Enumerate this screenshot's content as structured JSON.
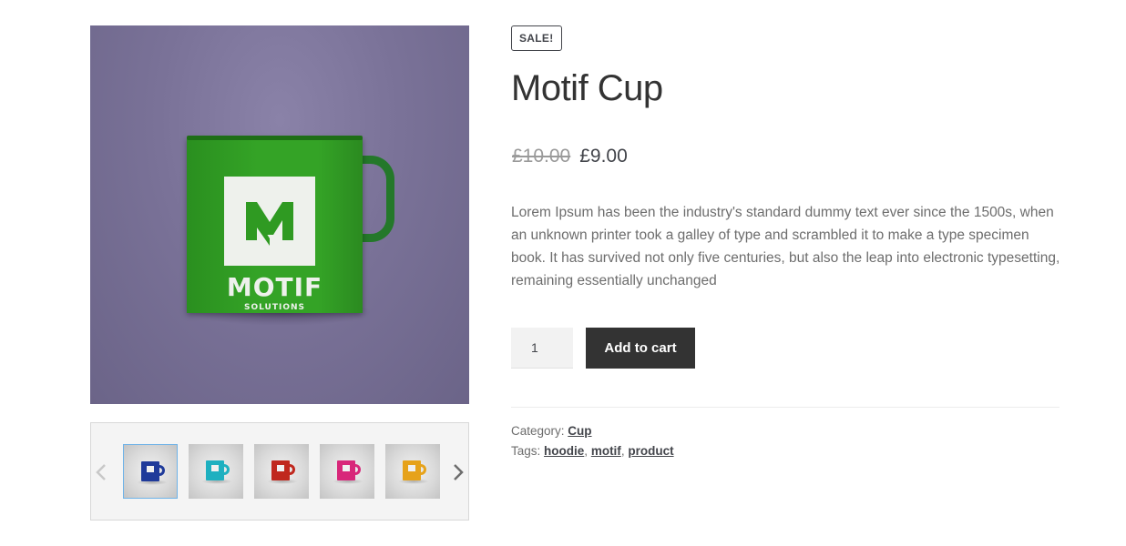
{
  "product": {
    "sale_badge": "SALE!",
    "title": "Motif Cup",
    "price_old": "£10.00",
    "price_new": "£9.00",
    "description": "Lorem Ipsum has been the industry's standard dummy text ever since the 1500s, when an unknown printer took a galley of type and scrambled it to make a type specimen book. It has survived not only five centuries, but also the leap into electronic typesetting, remaining essentially unchanged",
    "quantity": "1",
    "add_to_cart_label": "Add to cart"
  },
  "main_image": {
    "logo_text": "MOTIF",
    "logo_subtext": "SOLUTIONS",
    "mug_color": "#34a326",
    "background_color": "#7a7298"
  },
  "thumbnails": [
    {
      "color": "#1f3a9a",
      "active": true
    },
    {
      "color": "#1eb0c0",
      "active": false
    },
    {
      "color": "#c0281e",
      "active": false
    },
    {
      "color": "#d8277a",
      "active": false
    },
    {
      "color": "#e6a21a",
      "active": false
    }
  ],
  "meta": {
    "category_label": "Category:",
    "category_sep": " ",
    "category": "Cup",
    "tags_label": "Tags:",
    "tags": [
      "hoodie",
      "motif",
      "product"
    ],
    "tag_sep": ", "
  },
  "icons": {
    "prev": "chevron-left-icon",
    "next": "chevron-right-icon"
  }
}
